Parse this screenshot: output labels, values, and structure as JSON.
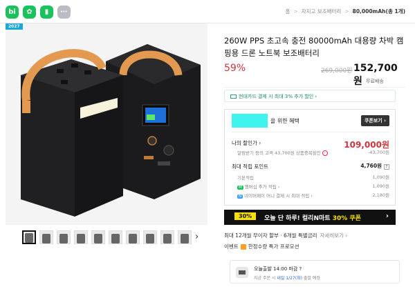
{
  "topbar": {
    "icons": [
      {
        "label": "bi",
        "name": "brand-icon"
      },
      {
        "label": "✿",
        "name": "store-icon"
      },
      {
        "label": "▮",
        "name": "bookmark-icon"
      },
      {
        "label": "⋯",
        "name": "more-icon"
      }
    ],
    "breadcrumbs": [
      "홈",
      "자지고 보조배터리",
      "80,000mAh(총 1개)"
    ],
    "separator": ">"
  },
  "hero": {
    "badge": "2027"
  },
  "thumbnails": {
    "count": 11
  },
  "product": {
    "title": "260W PPS 초고속 충전 80000mAh 대용량 차박 캠핑용 드론 노트북 보조배터리",
    "discount": "59%",
    "original_price": "269,000원",
    "price": "152,700원",
    "shipping": "무료배송"
  },
  "card_promo": "현대카드 결제 시 최대 3% 추가 할인 ›",
  "benefit": {
    "title_suffix": "을 위한 혜택",
    "coupon_button": "쿠폰보기 ›",
    "discount_label": "나의 할인가 ›",
    "discount_value": "109,000원",
    "discount_sub_label": "알림받기 등의 고객 43,700원 상품중복할인",
    "discount_sub_value": "-43,700원",
    "points_label": "최대 적립 포인트",
    "points_value": "4,760원",
    "points_rows": [
      {
        "label": "기본적립",
        "value": "1,090원",
        "tag": ""
      },
      {
        "label": "멤버십 추가 적립 ›",
        "value": "1,090원",
        "tag": "M"
      },
      {
        "label": "네이버페이 머니 결제 시 최대 적립 ›",
        "value": "2,180원",
        "tag": "N"
      }
    ]
  },
  "banner": {
    "pct": "30%",
    "text_prefix": "오늘 단 하루! 컬리N마트 ",
    "text_highlight": "30% 쿠폰",
    "arrow": "›"
  },
  "info": {
    "installment": "최대 12개월 무이자 할부 · 6개월 특별금리",
    "installment_more": "자세히보기 ›",
    "event_label": "이벤트",
    "event_text": "한정수량 특가 프로모션"
  },
  "delivery": {
    "line1": "오늘출발 14:00 마감 ?",
    "line2_prefix": "지금 주문 시 ",
    "line2_highlight": "내일 1/27(화)",
    "line2_suffix": " 출발 예정"
  },
  "colors": {
    "accent_red": "#d1333d",
    "brand_green": "#19c25a",
    "banner_yellow": "#f8e000",
    "highlight_cyan": "#3ff4ee"
  }
}
